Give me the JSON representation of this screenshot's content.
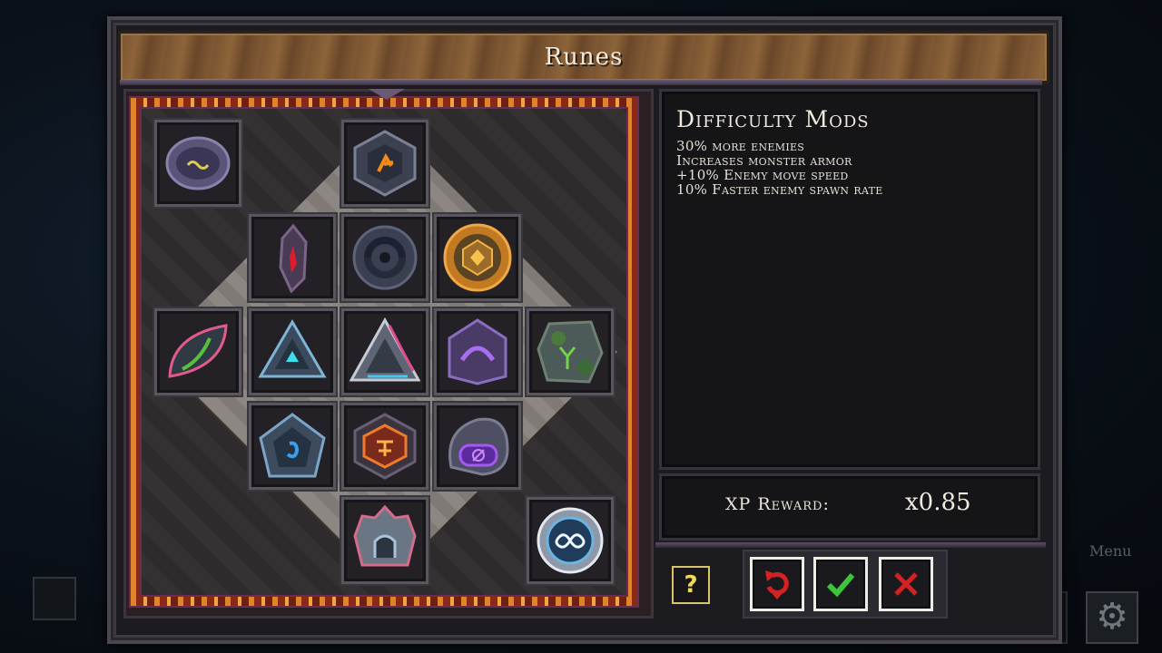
{
  "window": {
    "title": "Runes"
  },
  "info": {
    "title": "Difficulty Mods",
    "mods": [
      "30% more enemies",
      "Increases monster armor",
      "+10% Enemy move speed",
      "10% Faster enemy spawn rate"
    ]
  },
  "xp": {
    "label": "XP Reward:",
    "value": "x0.85"
  },
  "buttons": {
    "help_label": "?"
  },
  "background": {
    "menu_hint": "Menu"
  },
  "icons": {
    "help": "question-mark-icon",
    "reset": "reset-arrow-icon",
    "confirm": "checkmark-icon",
    "cancel": "x-close-icon",
    "gear": "gear-icon"
  },
  "runes": [
    "purple-wave-rune",
    "orange-glyph-hex-rune",
    "red-crystal-rune",
    "dark-circle-rune",
    "gold-sun-rune",
    "green-leaf-rune",
    "cyan-arrow-rune",
    "prism-triangle-rune",
    "purple-arch-rune",
    "mossy-stone-rune",
    "blue-hook-rune",
    "fire-hex-rune",
    "purple-null-rune",
    "crown-stone-rune",
    "infinity-orb-rune"
  ],
  "colors": {
    "header_wood": "#7a5431",
    "lava": "#b0461e",
    "help_yellow": "#f0d858",
    "confirm_green": "#3ec43a",
    "cancel_red": "#d42222",
    "reset_red": "#d42222"
  }
}
